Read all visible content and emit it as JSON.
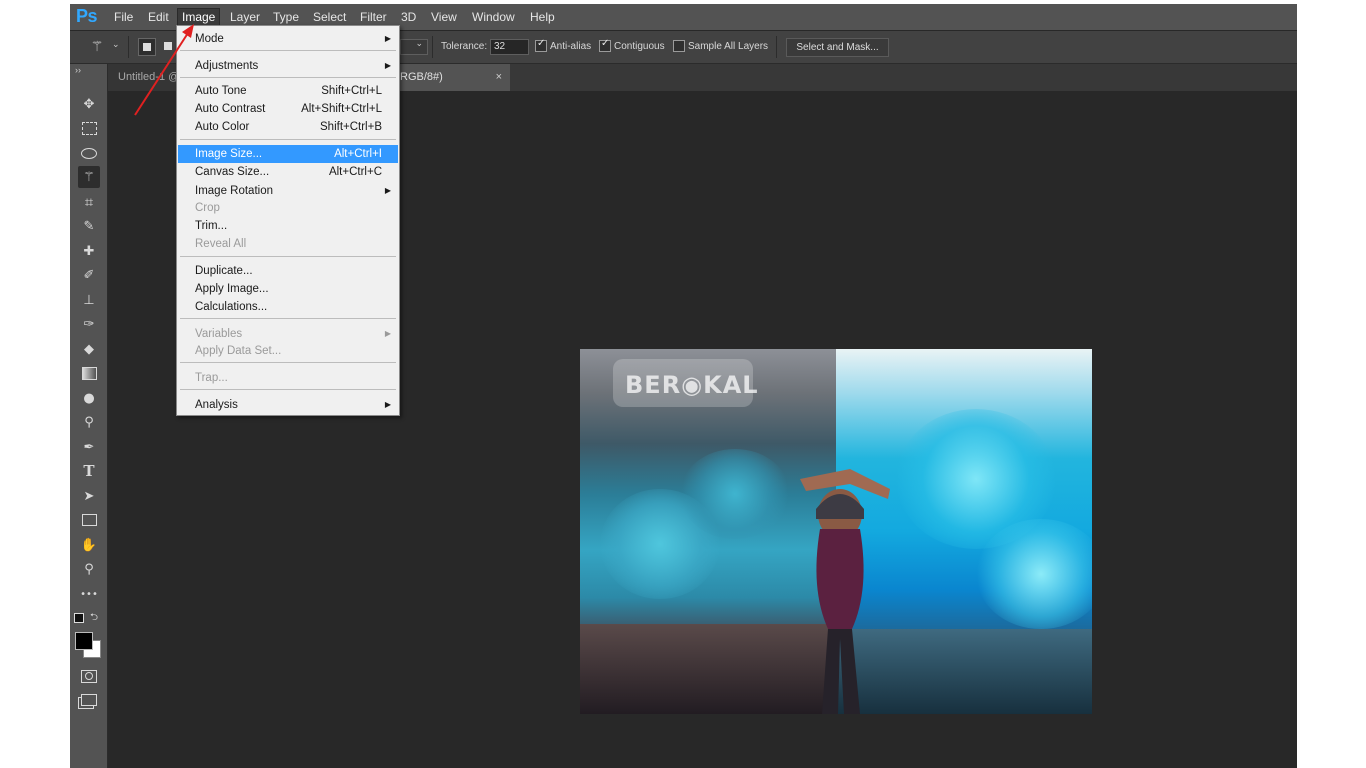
{
  "app": {
    "logo": "Ps"
  },
  "menubar": {
    "items": [
      "File",
      "Edit",
      "Image",
      "Layer",
      "Type",
      "Select",
      "Filter",
      "3D",
      "View",
      "Window",
      "Help"
    ],
    "active": "Image"
  },
  "options": {
    "tolerance_label": "Tolerance:",
    "tolerance_value": "32",
    "anti_alias_label": "Anti-alias",
    "anti_alias_checked": true,
    "contiguous_label": "Contiguous",
    "contiguous_checked": true,
    "sample_all_layers_label": "Sample All Layers",
    "sample_all_layers_checked": false,
    "select_and_mask_label": "Select and Mask..."
  },
  "tabs": [
    {
      "label": "Untitled-1 @",
      "active": false
    },
    {
      "label": "RGB/8#)",
      "active": true,
      "close": "×"
    }
  ],
  "toolbar": {
    "collapse": "››",
    "tools": [
      "move-icon",
      "marquee-icon",
      "lasso-icon",
      "magic-wand-icon",
      "crop-icon",
      "eyedropper-icon",
      "healing-brush-icon",
      "brush-icon",
      "clone-stamp-icon",
      "history-brush-icon",
      "eraser-icon",
      "gradient-icon",
      "blur-icon",
      "dodge-icon",
      "pen-icon",
      "type-icon",
      "path-selection-icon",
      "rectangle-icon",
      "hand-icon",
      "zoom-icon",
      "more-tools-icon",
      "swap-colors-icon",
      "quick-mask-icon",
      "screen-mode-icon"
    ],
    "type_glyph": "T",
    "more_glyph": "•••"
  },
  "menu": {
    "items": [
      {
        "label": "Mode",
        "submenu": true
      },
      {
        "sep": true
      },
      {
        "label": "Adjustments",
        "submenu": true
      },
      {
        "sep": true
      },
      {
        "label": "Auto Tone",
        "shortcut": "Shift+Ctrl+L"
      },
      {
        "label": "Auto Contrast",
        "shortcut": "Alt+Shift+Ctrl+L"
      },
      {
        "label": "Auto Color",
        "shortcut": "Shift+Ctrl+B"
      },
      {
        "sep": true
      },
      {
        "label": "Image Size...",
        "shortcut": "Alt+Ctrl+I",
        "highlighted": true
      },
      {
        "label": "Canvas Size...",
        "shortcut": "Alt+Ctrl+C"
      },
      {
        "label": "Image Rotation",
        "submenu": true
      },
      {
        "label": "Crop",
        "disabled": true
      },
      {
        "label": "Trim..."
      },
      {
        "label": "Reveal All",
        "disabled": true
      },
      {
        "sep": true
      },
      {
        "label": "Duplicate..."
      },
      {
        "label": "Apply Image..."
      },
      {
        "label": "Calculations..."
      },
      {
        "sep": true
      },
      {
        "label": "Variables",
        "submenu": true,
        "disabled": true
      },
      {
        "label": "Apply Data Set...",
        "disabled": true
      },
      {
        "sep": true
      },
      {
        "label": "Trap...",
        "disabled": true
      },
      {
        "sep": true
      },
      {
        "label": "Analysis",
        "submenu": true
      }
    ]
  },
  "canvas": {
    "watermark": "BER◉KAL"
  },
  "colors": {
    "accent": "#3399ff",
    "annotation_arrow": "#e02020",
    "logo": "#31a8ff"
  }
}
